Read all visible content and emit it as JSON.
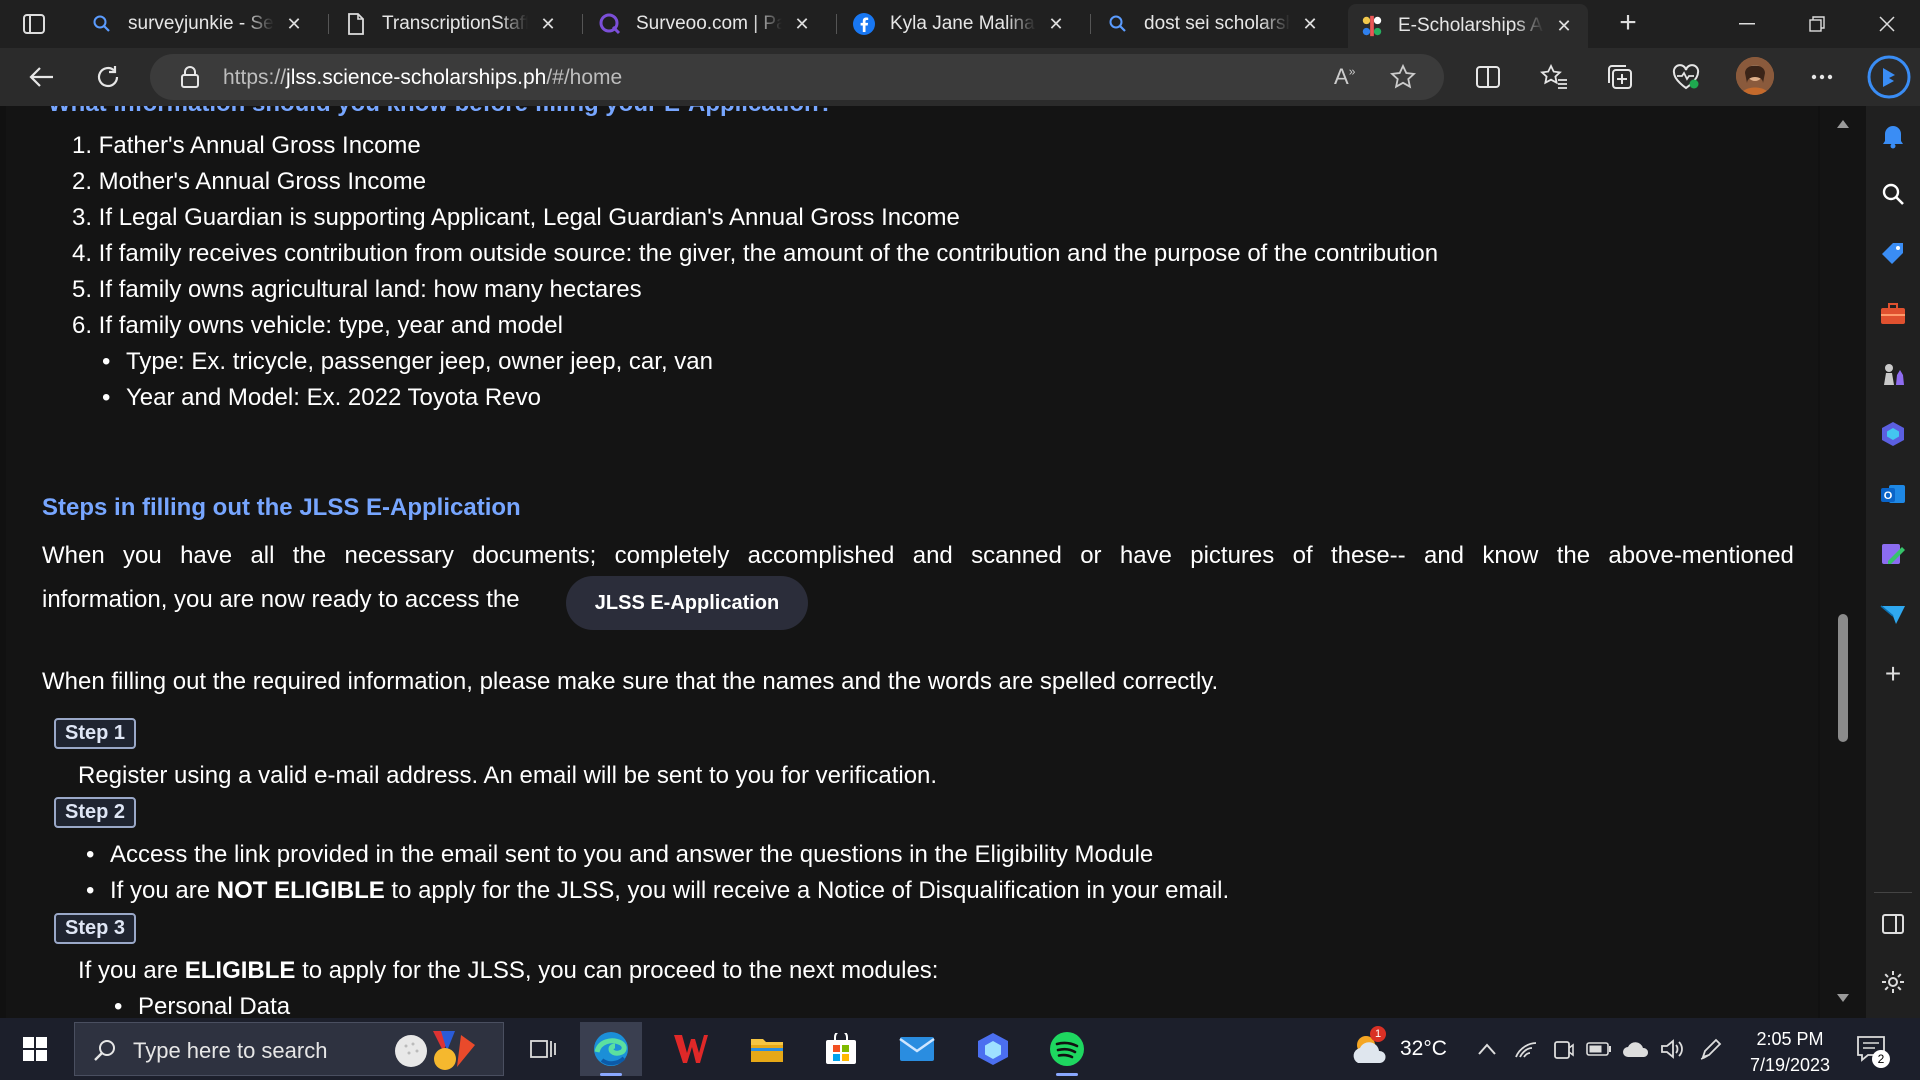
{
  "tabs": [
    {
      "title": "surveyjunkie - Search",
      "icon": "search-icon"
    },
    {
      "title": "TranscriptionStaff.com",
      "icon": "page-icon"
    },
    {
      "title": "Surveoo.com | Paid",
      "icon": "surveoo-logo-icon"
    },
    {
      "title": "Kyla Jane Malinao M",
      "icon": "facebook-icon"
    },
    {
      "title": "dost sei scholarship",
      "icon": "search-icon"
    },
    {
      "title": "E-Scholarships Appl",
      "icon": "escholarships-logo-icon",
      "active": true
    }
  ],
  "address": {
    "scheme": "https://",
    "host": "jlss.science-scholarships.ph",
    "path": "/#/home"
  },
  "page": {
    "clipped_heading": "What information should you know before filling your E-Application?",
    "income_list": [
      "1. Father's Annual Gross Income",
      "2. Mother's Annual Gross Income",
      "3. If Legal Guardian is supporting Applicant, Legal Guardian's Annual Gross Income",
      "4. If family receives contribution from outside source: the giver, the amount of the contribution and the purpose of the contribution",
      "5. If family owns agricultural land: how many hectares",
      "6. If family owns vehicle: type, year and model"
    ],
    "vehicle_sublist": [
      "Type: Ex. tricycle, passenger jeep, owner jeep, car, van",
      "Year and Model: Ex. 2022 Toyota Revo"
    ],
    "steps_heading": "Steps in filling out the JLSS E-Application",
    "intro_line1_words": [
      "When",
      "you",
      "have",
      "all",
      "the",
      "necessary",
      "documents;",
      "completely",
      "accomplished",
      "and",
      "scanned",
      "or",
      "have",
      "pictures",
      "of",
      "these--",
      "and",
      "know",
      "the",
      "above-mentioned"
    ],
    "intro_line2": "information, you are now ready to access the",
    "eapp_button": "JLSS E-Application",
    "spelling_note": "When filling out the required information, please make sure that the names and the words are spelled correctly.",
    "step1_label": "Step 1",
    "step1_text": "Register using a valid e-mail address. An email will be sent to you for verification.",
    "step2_label": "Step 2",
    "step2_b1": "Access the link provided in the email sent to you and answer the questions in the Eligibility Module",
    "step2_b2_pre": "If you are ",
    "step2_b2_bold": "NOT ELIGIBLE",
    "step2_b2_post": " to apply for the JLSS, you will receive a Notice of Disqualification in your email.",
    "step3_label": "Step 3",
    "step3_pre": "If you are ",
    "step3_bold": "ELIGIBLE",
    "step3_post": " to apply for the JLSS, you can proceed to the next modules:",
    "step3_b1": "Personal Data"
  },
  "taskbar": {
    "search_placeholder": "Type here to search",
    "weather_temp": "32°C",
    "weather_badge": "1",
    "time": "2:05 PM",
    "date": "7/19/2023",
    "notification_count": "2"
  },
  "colors": {
    "heading_blue": "#77a6ff",
    "page_bg": "#141414",
    "tabstrip_bg": "#202020",
    "toolbar_bg": "#2b2b2b",
    "taskbar_bg": "#1c1f2b"
  }
}
